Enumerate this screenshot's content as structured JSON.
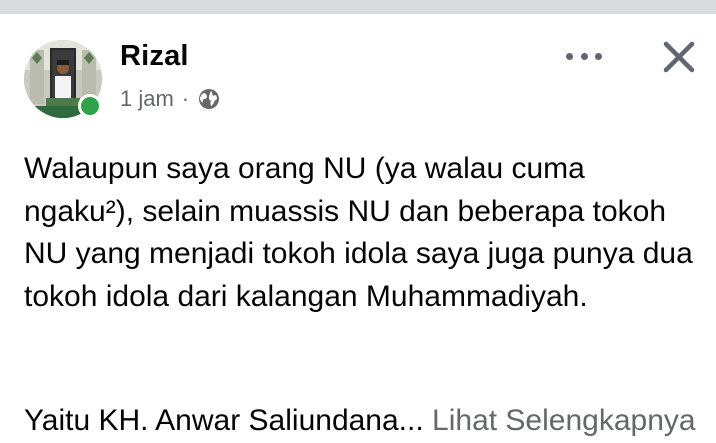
{
  "post": {
    "author_name": "Rizal",
    "time": "1 jam",
    "separator": "·",
    "privacy_icon": "globe-icon",
    "paragraph_1": "Walaupun saya orang NU (ya walau cuma ngaku²), selain muassis NU dan beberapa tokoh NU yang menjadi tokoh idola saya juga punya dua tokoh idola dari kalangan Muhammadiyah.",
    "paragraph_2_partial": "Yaitu KH. Anwar Saliundana...",
    "see_more": "Lihat Selengkapnya"
  },
  "header_actions": {
    "more_icon": "more-horizontal-icon",
    "close_icon": "close-icon"
  },
  "colors": {
    "online": "#31a24c",
    "secondary_text": "#65676b",
    "top_strip": "#d9dbdf"
  }
}
